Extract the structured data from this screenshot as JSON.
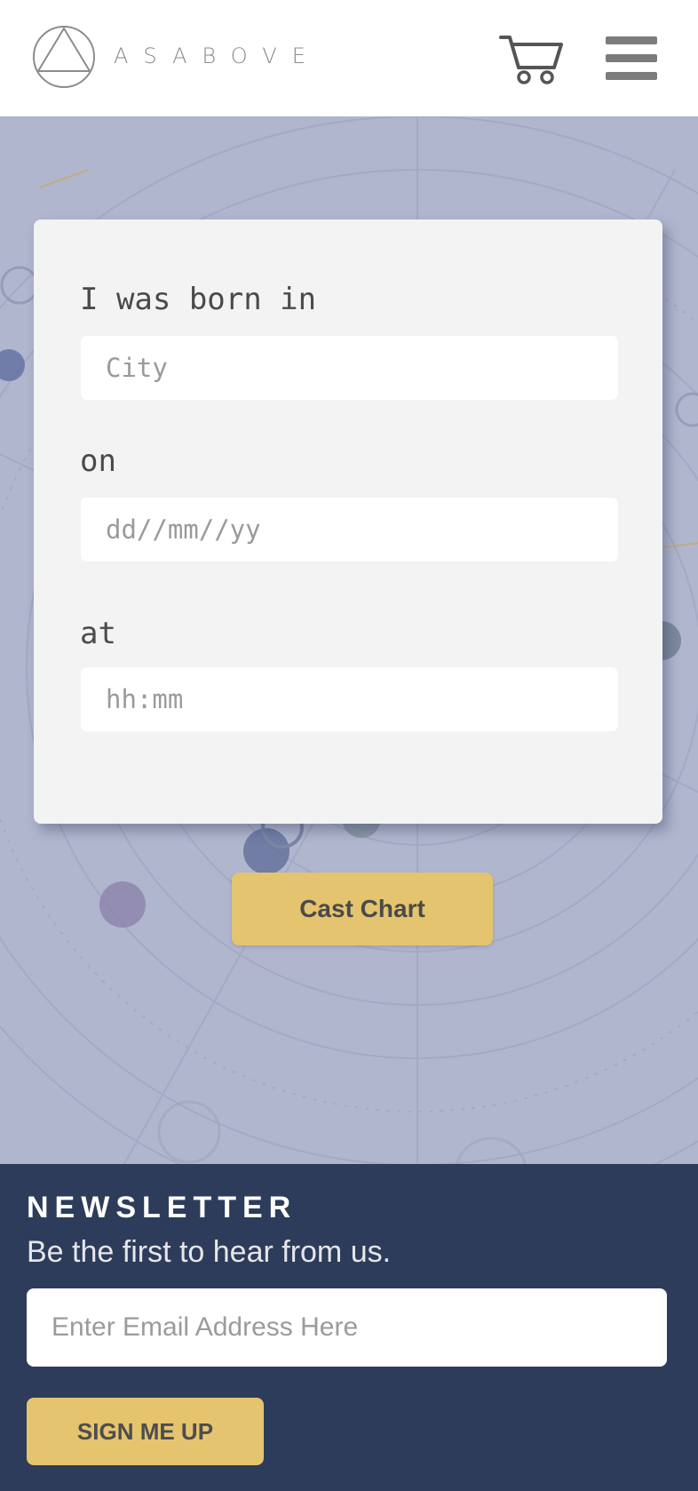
{
  "header": {
    "brand": "ASABOVE",
    "logo_icon": "triangle-in-circle-logo",
    "cart_icon": "shopping-cart-icon",
    "menu_icon": "hamburger-menu-icon"
  },
  "birth_form": {
    "label_place": "I was born in",
    "city_placeholder": "City",
    "city_value": "",
    "label_date": "on",
    "date_placeholder": "dd//mm//yy",
    "date_value": "",
    "label_time": "at",
    "time_placeholder": "hh:mm",
    "time_value": "",
    "submit_label": "Cast Chart"
  },
  "newsletter": {
    "title": "NEWSLETTER",
    "subtitle": "Be the first to hear from us.",
    "email_placeholder": "Enter Email Address Here",
    "email_value": "",
    "button_label": "SIGN ME UP"
  },
  "colors": {
    "accent": "#e5c46f",
    "hero_bg": "#b0b6cd",
    "newsletter_bg": "#2d3c5a",
    "card_bg": "#f3f3f3"
  }
}
